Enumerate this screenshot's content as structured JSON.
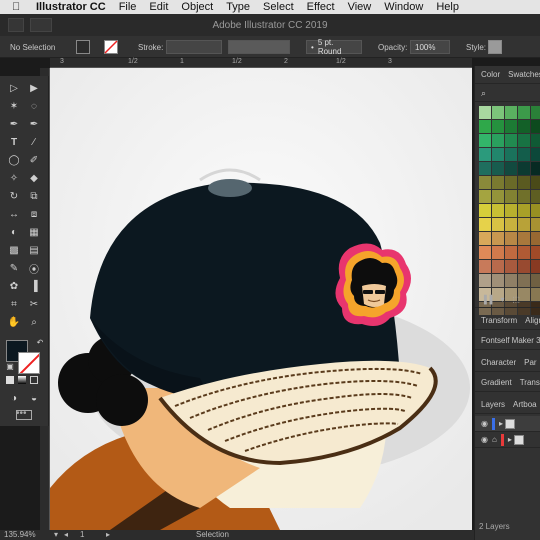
{
  "menubar": {
    "apple": "",
    "app": "Illustrator CC",
    "items": [
      "File",
      "Edit",
      "Object",
      "Type",
      "Select",
      "Effect",
      "View",
      "Window",
      "Help"
    ]
  },
  "titlebar": {
    "title": "Adobe Illustrator CC 2019"
  },
  "controlbar": {
    "selection": "No Selection",
    "stroke_label": "Stroke:",
    "brush": "5 pt. Round",
    "opacity_label": "Opacity:",
    "opacity_value": "100%",
    "style_label": "Style:"
  },
  "ruler": {
    "ticks": [
      "3",
      "1/2",
      "1",
      "1/2",
      "2",
      "1/2",
      "3"
    ]
  },
  "rightpanel": {
    "color_tab": "Color",
    "swatches_tab": "Swatches",
    "transform": "Transform",
    "align": "Align",
    "fontself": "Fontself Maker 3.",
    "character": "Character",
    "paragraph": "Par",
    "gradient": "Gradient",
    "transparency": "Trans",
    "layers": "Layers",
    "artboards": "Artboa",
    "layers_count": "2 Layers"
  },
  "statusbar": {
    "zoom": "135.94%",
    "artboard": "1",
    "tool": "Selection"
  },
  "colors": {
    "cap": "#0c1820",
    "canvas": "#f4f4f4",
    "badge_outer": "#e8356e",
    "badge_mid": "#f5a42b",
    "skin": "#f0c99a"
  }
}
